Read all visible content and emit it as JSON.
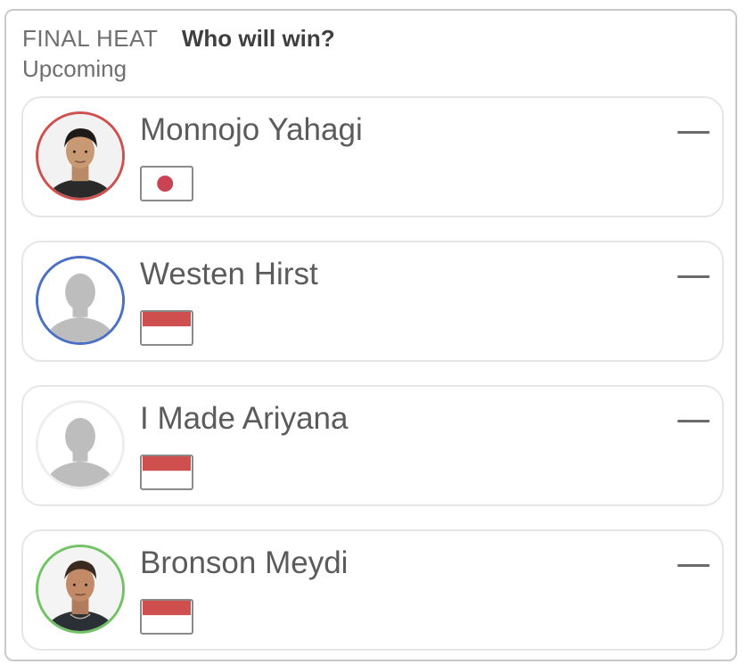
{
  "header": {
    "heat_label": "FINAL HEAT",
    "question": "Who will win?",
    "status": "Upcoming"
  },
  "competitors": [
    {
      "name": "Monnojo Yahagi",
      "ring_color": "#d0504f",
      "avatar": "photo",
      "flag": "japan-flag-icon",
      "score": "—"
    },
    {
      "name": "Westen Hirst",
      "ring_color": "#4a6fc4",
      "avatar": "silhouette",
      "flag": "indonesia-flag-icon",
      "score": "—"
    },
    {
      "name": "I Made Ariyana",
      "ring_color": "#eeeeee",
      "avatar": "silhouette",
      "flag": "indonesia-flag-icon",
      "score": "—"
    },
    {
      "name": "Bronson Meydi",
      "ring_color": "#72c366",
      "avatar": "photo",
      "flag": "indonesia-flag-icon",
      "score": "—"
    }
  ],
  "colors": {
    "flag_red": "#cf4f4f",
    "japan_dot": "#c84454",
    "silhouette": "#bdbdbd"
  }
}
